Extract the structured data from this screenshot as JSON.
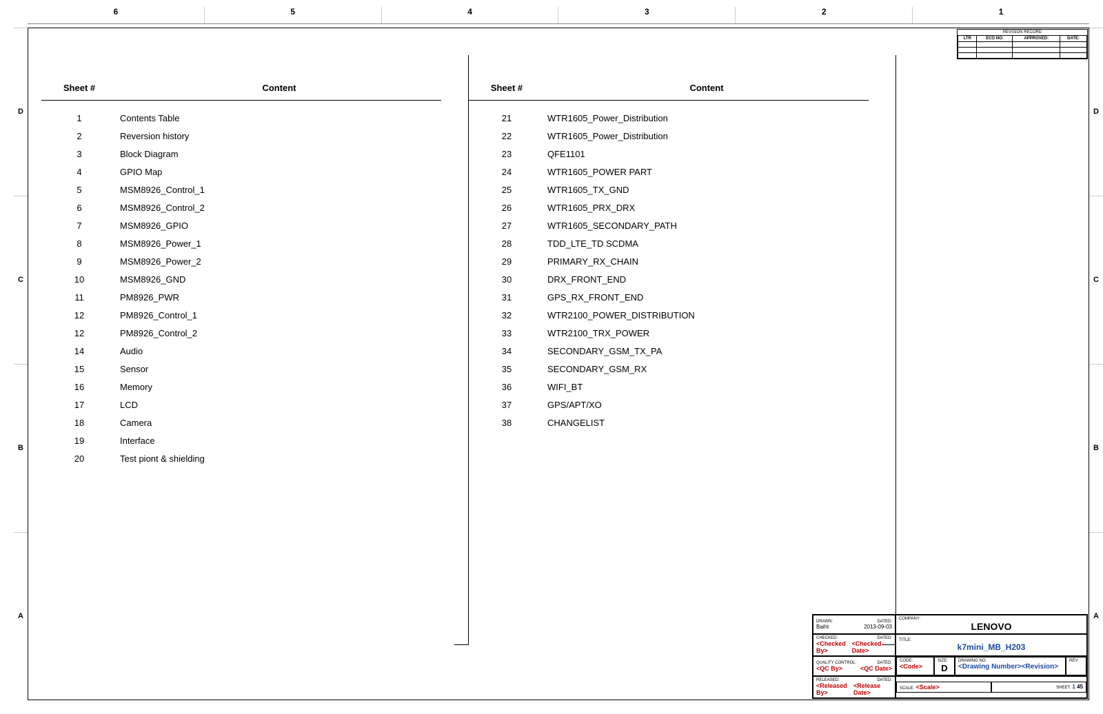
{
  "grid": {
    "cols": [
      "6",
      "5",
      "4",
      "3",
      "2",
      "1"
    ],
    "rows": [
      "D",
      "C",
      "B",
      "A"
    ]
  },
  "table_header": {
    "num": "Sheet #",
    "content": "Content"
  },
  "left_entries": [
    {
      "n": "1",
      "c": "Contents Table"
    },
    {
      "n": "2",
      "c": "Reversion history"
    },
    {
      "n": "3",
      "c": "Block Diagram"
    },
    {
      "n": "4",
      "c": "GPIO Map"
    },
    {
      "n": "5",
      "c": "MSM8926_Control_1"
    },
    {
      "n": "6",
      "c": "MSM8926_Control_2"
    },
    {
      "n": "7",
      "c": "MSM8926_GPIO"
    },
    {
      "n": "8",
      "c": "MSM8926_Power_1"
    },
    {
      "n": "9",
      "c": "MSM8926_Power_2"
    },
    {
      "n": "10",
      "c": "MSM8926_GND"
    },
    {
      "n": "11",
      "c": "PM8926_PWR"
    },
    {
      "n": "12",
      "c": "PM8926_Control_1"
    },
    {
      "n": "12",
      "c": "PM8926_Control_2"
    },
    {
      "n": "14",
      "c": "Audio"
    },
    {
      "n": "15",
      "c": "Sensor"
    },
    {
      "n": "16",
      "c": "Memory"
    },
    {
      "n": "17",
      "c": "LCD"
    },
    {
      "n": "18",
      "c": "Camera"
    },
    {
      "n": "19",
      "c": "Interface"
    },
    {
      "n": "20",
      "c": "Test piont & shielding"
    }
  ],
  "right_entries": [
    {
      "n": "21",
      "c": "WTR1605_Power_Distribution"
    },
    {
      "n": "22",
      "c": "WTR1605_Power_Distribution"
    },
    {
      "n": "23",
      "c": "QFE1101"
    },
    {
      "n": "24",
      "c": "WTR1605_POWER PART"
    },
    {
      "n": "25",
      "c": "WTR1605_TX_GND"
    },
    {
      "n": "26",
      "c": "WTR1605_PRX_DRX"
    },
    {
      "n": "27",
      "c": "WTR1605_SECONDARY_PATH"
    },
    {
      "n": "28",
      "c": "TDD_LTE_TD SCDMA"
    },
    {
      "n": "29",
      "c": "PRIMARY_RX_CHAIN"
    },
    {
      "n": "30",
      "c": "DRX_FRONT_END"
    },
    {
      "n": "31",
      "c": "GPS_RX_FRONT_END"
    },
    {
      "n": "32",
      "c": "WTR2100_POWER_DISTRIBUTION"
    },
    {
      "n": "33",
      "c": "WTR2100_TRX_POWER"
    },
    {
      "n": "34",
      "c": "SECONDARY_GSM_TX_PA"
    },
    {
      "n": "35",
      "c": "SECONDARY_GSM_RX"
    },
    {
      "n": "36",
      "c": "WIFI_BT"
    },
    {
      "n": "37",
      "c": "GPS/APT/XO"
    },
    {
      "n": "38",
      "c": "CHANGELIST"
    }
  ],
  "revision_record": {
    "title": "REVISION RECORD",
    "headers": [
      "LTR",
      "ECO NO:",
      "APPROVED:",
      "DATE:"
    ]
  },
  "title_block": {
    "drawn": {
      "lbl": "DRAWN:",
      "by": "Baiht",
      "dated_lbl": "DATED:",
      "dated": "2013-09-03"
    },
    "checked": {
      "lbl": "CHECKED:",
      "by": "<Checked By>",
      "dated_lbl": "DATED:",
      "dated": "<Checked Date>"
    },
    "qc": {
      "lbl": "QUALITY CONTROL:",
      "by": "<QC By>",
      "dated_lbl": "DATED:",
      "dated": "<QC Date>"
    },
    "released": {
      "lbl": "RELEASED:",
      "by": "<Released By>",
      "dated_lbl": "DATED:",
      "dated": "<Release Date>"
    },
    "company_lbl": "COMPANY:",
    "company": "LENOVO",
    "title_lbl": "TITLE:",
    "title": "k7mini_MB_H203",
    "code_lbl": "CODE:",
    "code": "<Code>",
    "size_lbl": "SIZE:",
    "size": "D",
    "dwgno_lbl": "DRAWING NO:",
    "dwgno": "<Drawing Number><Revision>",
    "rev_lbl": "REV:",
    "scale_lbl": "SCALE:",
    "scale": "<Scale>",
    "sheet_lbl": "SHEET:",
    "sheet_cur": "1",
    "sheet_tot": "45"
  }
}
